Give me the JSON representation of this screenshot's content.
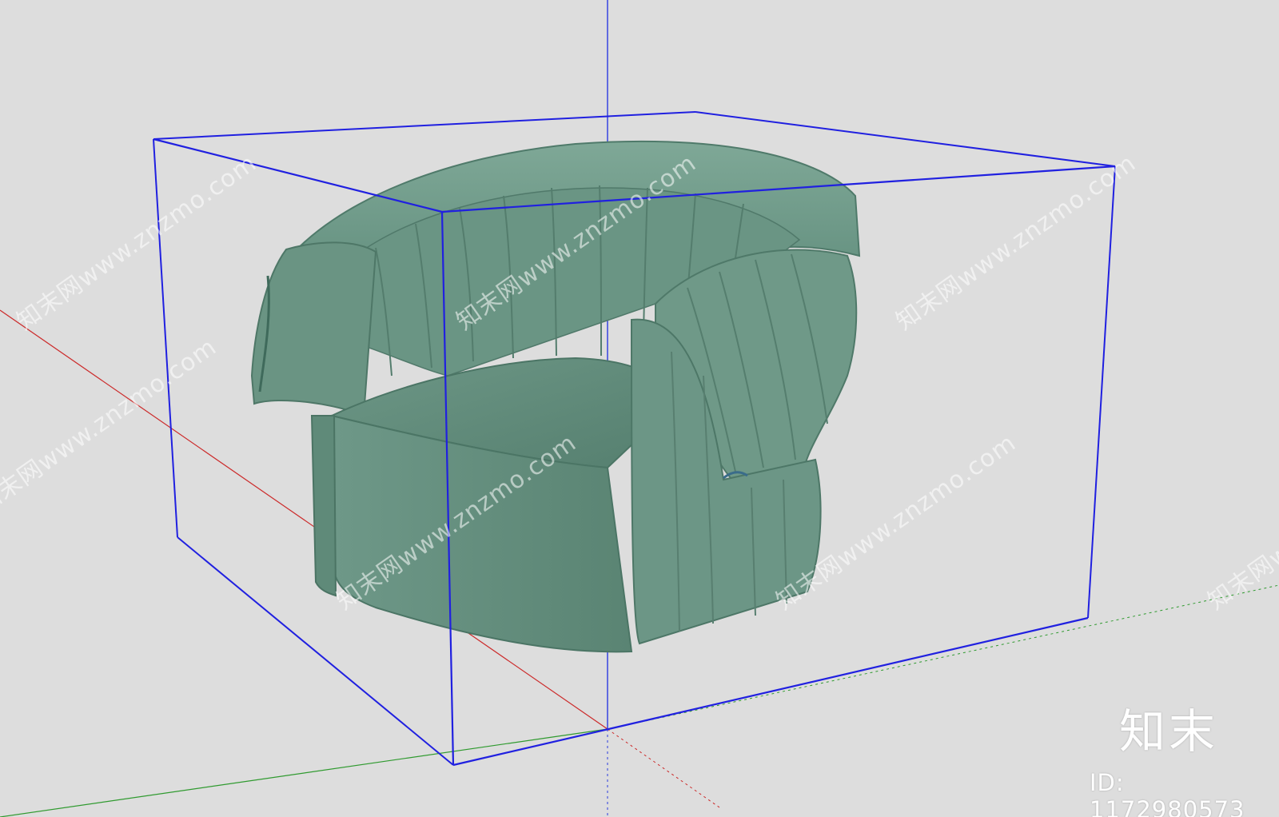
{
  "watermark": {
    "text": "知末网www.znzmo.com"
  },
  "brand": {
    "name": "知末",
    "id_label": "ID: 1172980573"
  },
  "model": {
    "object": "armchair",
    "fabric_color": "#6f9a89"
  },
  "colors": {
    "background": "#dddddd",
    "bounding_box": "#2020e0",
    "axis_red": "#cc2a2a",
    "axis_green": "#2f9a2f",
    "axis_blue": "#2a3ae0"
  }
}
